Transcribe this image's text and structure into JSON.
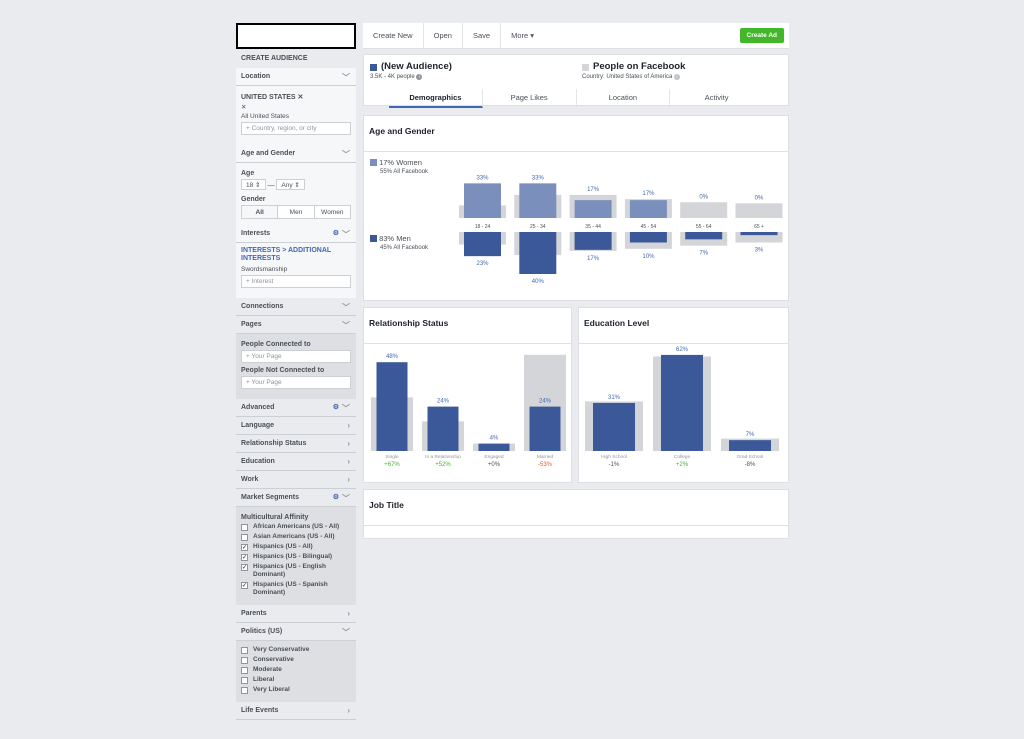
{
  "sidebar": {
    "create_audience": "CREATE AUDIENCE",
    "location": {
      "label": "Location",
      "selected": "UNITED STATES",
      "remove_mark": "✕",
      "sub": "All United States",
      "placeholder": "Country, region, or city"
    },
    "age_gender": {
      "label": "Age and Gender",
      "age_label": "Age",
      "age_from": "18",
      "age_sep": "—",
      "age_to": "Any",
      "gender_label": "Gender",
      "gender_options": [
        "All",
        "Men",
        "Women"
      ],
      "gender_selected": "All"
    },
    "interests": {
      "label": "Interests",
      "path": "INTERESTS > ADDITIONAL INTERESTS",
      "value": "Swordsmanship",
      "placeholder": "Interest"
    },
    "connections": {
      "label": "Connections"
    },
    "pages": {
      "label": "Pages",
      "connected_label": "People Connected to",
      "connected_placeholder": "Your Page",
      "not_connected_label": "People Not Connected to",
      "not_connected_placeholder": "Your Page"
    },
    "advanced": {
      "label": "Advanced"
    },
    "collapsed_sections": [
      "Language",
      "Relationship Status",
      "Education",
      "Work"
    ],
    "market_segments": {
      "label": "Market Segments",
      "group_label": "Multicultural Affinity",
      "items": [
        {
          "label": "African Americans (US - All)",
          "checked": false
        },
        {
          "label": "Asian Americans (US - All)",
          "checked": false
        },
        {
          "label": "Hispanics (US - All)",
          "checked": true
        },
        {
          "label": "Hispanics (US - Bilingual)",
          "checked": true
        },
        {
          "label": "Hispanics (US - English Dominant)",
          "checked": true
        },
        {
          "label": "Hispanics (US - Spanish Dominant)",
          "checked": true
        }
      ]
    },
    "parents": {
      "label": "Parents"
    },
    "politics": {
      "label": "Politics (US)",
      "items": [
        {
          "label": "Very Conservative",
          "checked": false
        },
        {
          "label": "Conservative",
          "checked": false
        },
        {
          "label": "Moderate",
          "checked": false
        },
        {
          "label": "Liberal",
          "checked": false
        },
        {
          "label": "Very Liberal",
          "checked": false
        }
      ]
    },
    "life_events": {
      "label": "Life Events"
    }
  },
  "toolbar": {
    "create_new": "Create New",
    "open": "Open",
    "save": "Save",
    "more": "More ▾",
    "create_ad": "Create Ad"
  },
  "audience": {
    "new_title": "(New Audience)",
    "new_sub": "3.5K - 4K people",
    "info_mark": "i",
    "fb_title": "People on Facebook",
    "fb_sub": "Country: United States of America"
  },
  "tabs": [
    {
      "label": "Demographics",
      "active": true
    },
    {
      "label": "Page Likes",
      "active": false
    },
    {
      "label": "Location",
      "active": false
    },
    {
      "label": "Activity",
      "active": false
    }
  ],
  "colors": {
    "audience": "#3b5998",
    "women": "#7b8fbd",
    "facebook": "#d3d5d9",
    "positive": "#42b72a",
    "negative": "#e9573f"
  },
  "chart_data": [
    {
      "type": "bar",
      "title": "Age and Gender",
      "categories": [
        "18 - 24",
        "25 - 34",
        "35 - 44",
        "45 - 54",
        "55 - 64",
        "65 +"
      ],
      "women_legend": "17% Women",
      "women_fb": "55% All Facebook",
      "men_legend": "83% Men",
      "men_fb": "45% All Facebook",
      "series": [
        {
          "name": "17% Women",
          "values": [
            33,
            33,
            17,
            17,
            0,
            0
          ],
          "labels": [
            "33%",
            "33%",
            "17%",
            "17%",
            "0%",
            "0%"
          ],
          "facebook": [
            12,
            22,
            22,
            18,
            15,
            14
          ]
        },
        {
          "name": "83% Men",
          "values": [
            23,
            40,
            17,
            10,
            7,
            3
          ],
          "labels": [
            "23%",
            "40%",
            "17%",
            "10%",
            "7%",
            "3%"
          ],
          "facebook": [
            12,
            22,
            18,
            16,
            13,
            10
          ]
        }
      ]
    },
    {
      "type": "bar",
      "title": "Relationship Status",
      "categories": [
        "Single",
        "In a Relationship",
        "Engaged",
        "Married"
      ],
      "values": [
        48,
        24,
        4,
        24
      ],
      "labels": [
        "48%",
        "24%",
        "4%",
        "24%"
      ],
      "facebook": [
        29,
        16,
        4,
        52
      ],
      "changes": [
        "+67%",
        "+52%",
        "+0%",
        "-53%"
      ]
    },
    {
      "type": "bar",
      "title": "Education Level",
      "categories": [
        "High School",
        "College",
        "Grad School"
      ],
      "values": [
        31,
        62,
        7
      ],
      "labels": [
        "31%",
        "62%",
        "7%"
      ],
      "facebook": [
        32,
        61,
        8
      ],
      "changes": [
        "-1%",
        "+2%",
        "-8%"
      ]
    }
  ],
  "job_title": {
    "title": "Job Title"
  }
}
